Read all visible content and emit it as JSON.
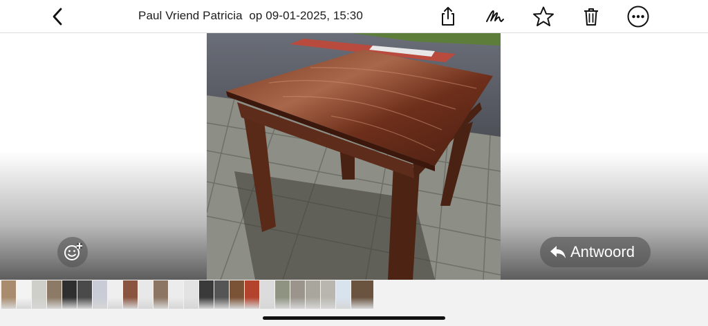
{
  "header": {
    "title": "Paul Vriend Patricia  op 09-01-2025, 15:30",
    "back_icon": "chevron-left-icon",
    "actions": [
      "share-icon",
      "markup-icon",
      "star-icon",
      "trash-icon",
      "more-icon"
    ]
  },
  "viewer": {
    "photo_subject": "wooden-table-photo",
    "reply_label": "Antwoord",
    "reply_icon": "reply-arrow-icon",
    "reaction_icon": "add-reaction-icon"
  },
  "thumbnails": {
    "count": 24,
    "selected_index": 23,
    "colors": [
      "#a98c6d",
      "#f3f3f3",
      "#cfcfc9",
      "#8c7a66",
      "#2f2f2f",
      "#4a4a4a",
      "#c9ccd6",
      "#efefef",
      "#8a5540",
      "#e8e8e8",
      "#8c7563",
      "#ececec",
      "#e3e3e3",
      "#3a3a3a",
      "#555555",
      "#7a5236",
      "#b3432c",
      "#dcdcdc",
      "#8f9382",
      "#9a948c",
      "#a9a79d",
      "#b8b6ae",
      "#d8e3ee",
      "#6a5440"
    ]
  },
  "colors": {
    "accent": "#000000",
    "button_bg": "#505050",
    "header_bg": "#ffffff"
  }
}
